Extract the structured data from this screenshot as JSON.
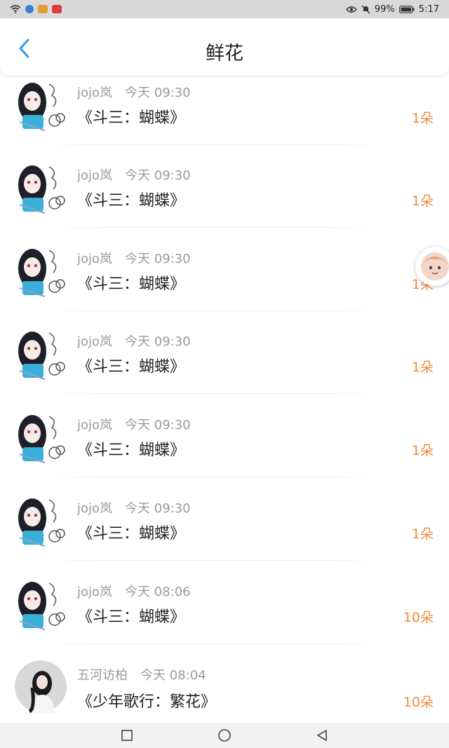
{
  "status_bar": {
    "battery": "99%",
    "time": "5:17",
    "icons": [
      "wifi-icon",
      "app-icon",
      "app-icon",
      "app-icon",
      "eye-icon",
      "mute-icon",
      "battery-icon"
    ]
  },
  "header": {
    "title": "鲜花",
    "back_icon": "chevron-left-icon"
  },
  "items": [
    {
      "user": "jojo岚",
      "time": "今天 09:30",
      "title": "《斗三：蝴蝶》",
      "count": "1朵"
    },
    {
      "user": "jojo岚",
      "time": "今天 09:30",
      "title": "《斗三：蝴蝶》",
      "count": "1朵"
    },
    {
      "user": "jojo岚",
      "time": "今天 09:30",
      "title": "《斗三：蝴蝶》",
      "count": "1朵"
    },
    {
      "user": "jojo岚",
      "time": "今天 09:30",
      "title": "《斗三：蝴蝶》",
      "count": "1朵"
    },
    {
      "user": "jojo岚",
      "time": "今天 09:30",
      "title": "《斗三：蝴蝶》",
      "count": "1朵"
    },
    {
      "user": "jojo岚",
      "time": "今天 09:30",
      "title": "《斗三：蝴蝶》",
      "count": "1朵"
    },
    {
      "user": "jojo岚",
      "time": "今天 08:06",
      "title": "《斗三：蝴蝶》",
      "count": "10朵"
    },
    {
      "user": "五河访柏",
      "time": "今天 08:04",
      "title": "《少年歌行：繁花》",
      "count": "10朵"
    }
  ],
  "colors": {
    "accent": "#2a9af0",
    "count": "#f08a3a",
    "meta": "#9a9a9a"
  },
  "nav_bar": {
    "icons": [
      "recent-apps-icon",
      "home-icon",
      "back-icon"
    ]
  }
}
